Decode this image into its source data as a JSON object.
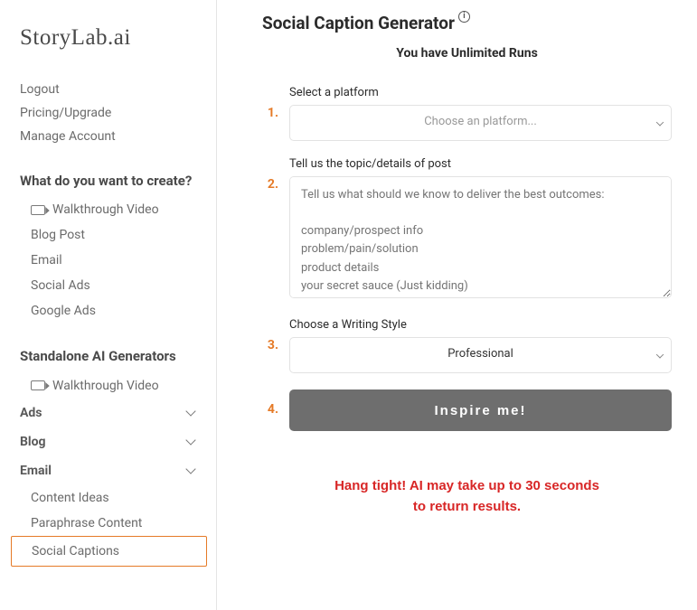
{
  "logo": "StoryLab.ai",
  "sidebar": {
    "top_links": [
      {
        "label": "Logout"
      },
      {
        "label": "Pricing/Upgrade"
      },
      {
        "label": "Manage Account"
      }
    ],
    "create_heading": "What do you want to create?",
    "create_items": [
      {
        "label": "Walkthrough Video",
        "icon": "video"
      },
      {
        "label": "Blog Post"
      },
      {
        "label": "Email"
      },
      {
        "label": "Social Ads"
      },
      {
        "label": "Google Ads"
      }
    ],
    "standalone_heading": "Standalone AI Generators",
    "standalone_video": {
      "label": "Walkthrough Video"
    },
    "categories": [
      {
        "label": "Ads"
      },
      {
        "label": "Blog"
      },
      {
        "label": "Email"
      }
    ],
    "bottom_items": [
      {
        "label": "Content Ideas"
      },
      {
        "label": "Paraphrase Content"
      },
      {
        "label": "Social Captions",
        "selected": true
      }
    ]
  },
  "main": {
    "title": "Social Caption Generator",
    "subnote": "You have Unlimited Runs",
    "steps": {
      "s1": {
        "num": "1.",
        "label": "Select a platform",
        "placeholder": "Choose an platform..."
      },
      "s2": {
        "num": "2.",
        "label": "Tell us the topic/details of post",
        "placeholder": "Tell us what should we know to deliver the best outcomes:\n\ncompany/prospect info\nproblem/pain/solution\nproduct details\nyour secret sauce (Just kidding)"
      },
      "s3": {
        "num": "3.",
        "label": "Choose a Writing Style",
        "value": "Professional"
      },
      "s4": {
        "num": "4.",
        "button": "Inspire me!"
      }
    },
    "wait_line1": "Hang tight! AI may take up to 30 seconds",
    "wait_line2": "to return results."
  }
}
